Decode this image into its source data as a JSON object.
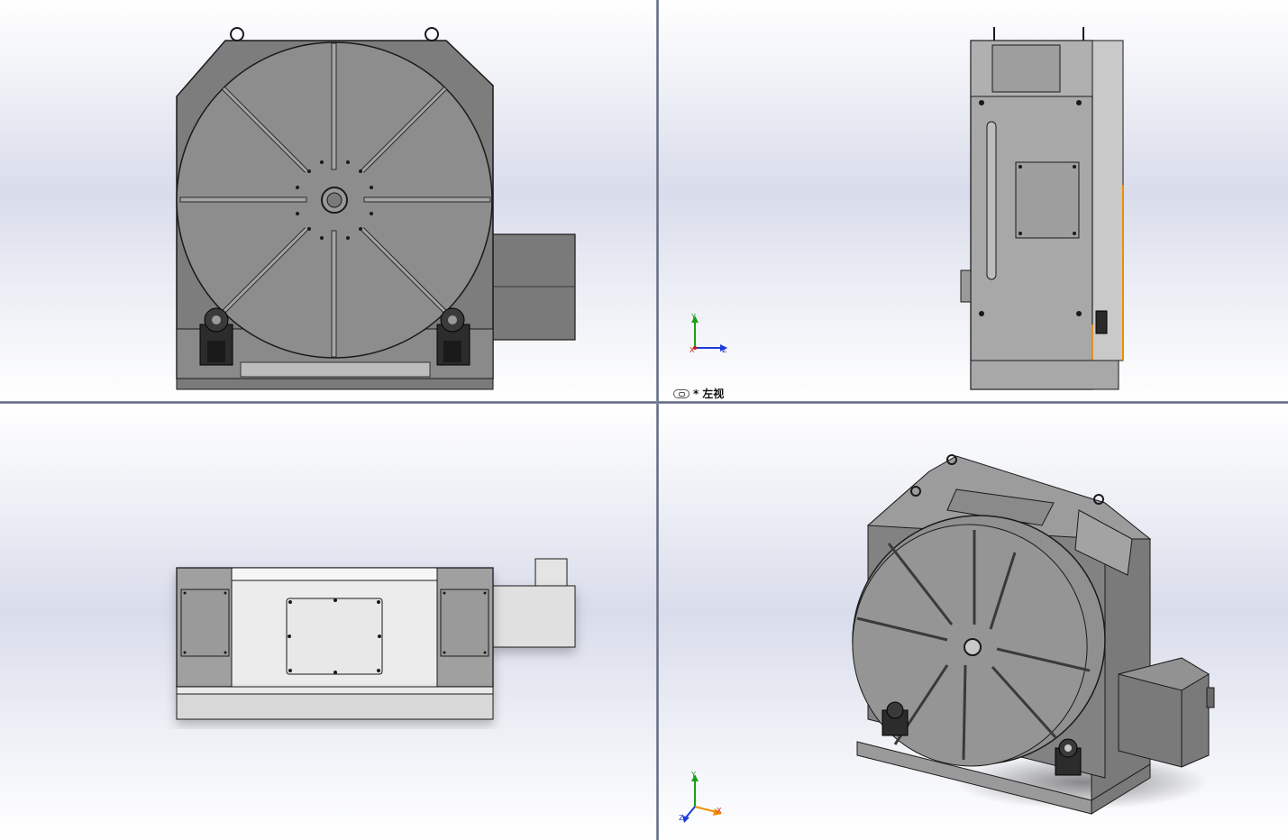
{
  "viewports": {
    "front": {
      "name": "Front"
    },
    "left": {
      "name": "Left",
      "label_prefix": "*",
      "label_text": "左视"
    },
    "top": {
      "name": "Top"
    },
    "iso": {
      "name": "Isometric"
    }
  },
  "triad": {
    "x": "X",
    "y": "Y",
    "z": "Z"
  },
  "colors": {
    "body": "#7c7c7c",
    "body_light": "#9a9a9a",
    "table": "#8e8e8e",
    "outline": "#1a1a1a",
    "highlight": "#f08c00",
    "axis_x": "#d01818",
    "axis_y": "#18a018",
    "axis_z": "#1c3cd8"
  }
}
